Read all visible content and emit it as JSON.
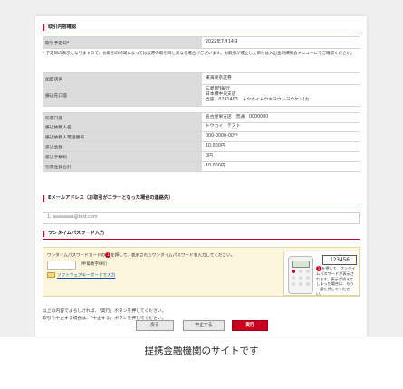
{
  "transaction": {
    "section_title": "取引内容確認",
    "date_label": "取引予定日*",
    "date_value": "2022年7月14日",
    "note": "* 予定日の表示となりますので、お取引の時間によっては実際の取引日と異なる場合がございます。お取引が成立した日付は入出金明細照会メニューにてご確認ください。",
    "store_label": "加盟店名",
    "store_value": "東海東京証券",
    "dest_label": "振込先口座",
    "dest_bank": "三菱UFJ銀行",
    "dest_branch": "日本橋中央支店",
    "dest_account": "当座　0291403　トウカイトウキヨウシヨウケン(カ"
  },
  "details": {
    "rows": [
      {
        "label": "引落口座",
        "value": "名古屋栄支店　普通　0000000"
      },
      {
        "label": "振込依頼人名",
        "value": "トウカイ　テスト"
      },
      {
        "label": "振込依頼人電話番号",
        "value": "000-0000-00**"
      },
      {
        "label": "振込金額",
        "value": "10,000円"
      },
      {
        "label": "振込手数料",
        "value": "0円"
      },
      {
        "label": "引落金額合計",
        "value": "10,000円"
      }
    ]
  },
  "email": {
    "section_title": "Eメールアドレス（お取引がエラーとなった場合の連絡先）",
    "value": "1: aaaaaaaa@test.com"
  },
  "otp": {
    "section_title": "ワンタイムパスワード入力",
    "instruction_pre": "ワンタイムパスワードカードの",
    "instruction_post": "を押して、表示されたワンタイムパスワードを入力してください。",
    "badge": "1",
    "input_hint": "（半角数字6桁）",
    "keyboard_link": "ソフトウェアキーボードで入力",
    "lcd_value": "123456",
    "device_note": "を押して、ワンタイムパスワードが表示されます。表示が消えてしまった場合は、もう一度を押してください。"
  },
  "confirm": {
    "line1": "以上の内容でよろしければ、「実行」ボタンを押してください。",
    "line2": "取引を中止する場合は、「中止する」ボタンを押してください。"
  },
  "buttons": {
    "back": "戻る",
    "cancel": "中止する",
    "execute": "実行"
  },
  "caption": "提携金融機関のサイトです",
  "colors": {
    "accent": "#c9001f",
    "label_bg": "#dcdcdc",
    "otp_bg": "#fcf6dc"
  }
}
